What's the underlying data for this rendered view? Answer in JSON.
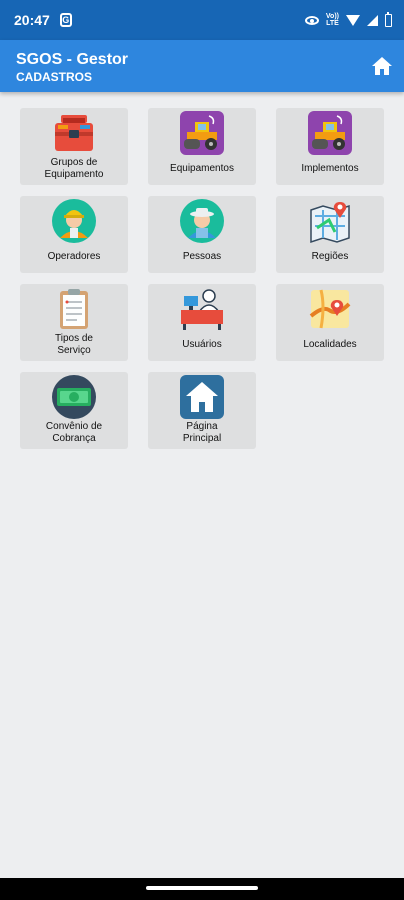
{
  "status_bar": {
    "time": "20:47",
    "notification_glyph": "G",
    "volte": "Vo))\nLTE"
  },
  "app_bar": {
    "title": "SGOS - Gestor",
    "subtitle": "CADASTROS",
    "home_icon": "home-icon"
  },
  "tiles": [
    {
      "label": "Grupos de\nEquipamento",
      "icon": "toolbox-icon"
    },
    {
      "label": "Equipamentos",
      "icon": "road-roller-icon"
    },
    {
      "label": "Implementos",
      "icon": "road-roller-icon"
    },
    {
      "label": "Operadores",
      "icon": "worker-icon"
    },
    {
      "label": "Pessoas",
      "icon": "farmer-icon"
    },
    {
      "label": "Regiões",
      "icon": "map-pin-icon"
    },
    {
      "label": "Tipos de\nServiço",
      "icon": "clipboard-icon"
    },
    {
      "label": "Usuários",
      "icon": "user-desk-icon"
    },
    {
      "label": "Localidades",
      "icon": "location-map-icon"
    },
    {
      "label": "Convênio de\nCobrança",
      "icon": "money-icon"
    },
    {
      "label": "Página\nPrincipal",
      "icon": "home-page-icon"
    }
  ],
  "colors": {
    "status_bar": "#1766b5",
    "app_bar": "#2e86de",
    "background": "#edeef0",
    "tile": "#dedfe0"
  }
}
